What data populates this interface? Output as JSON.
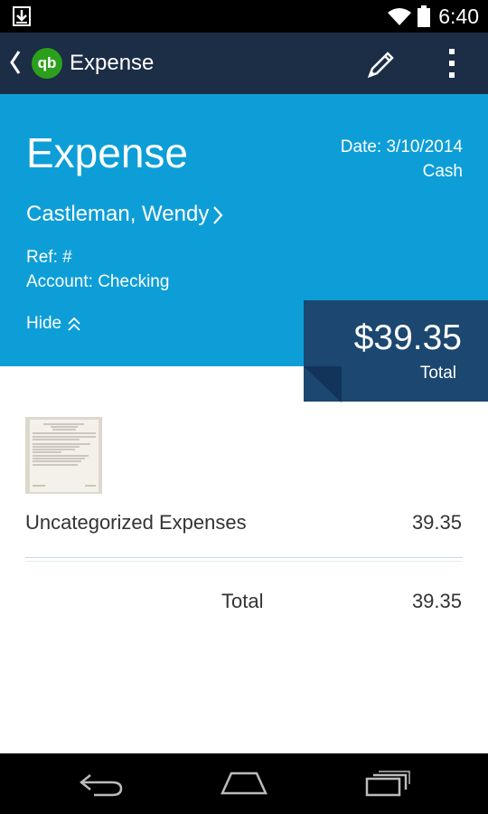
{
  "status_bar": {
    "time": "6:40"
  },
  "action_bar": {
    "app_logo": "qb",
    "title": "Expense"
  },
  "header": {
    "title": "Expense",
    "date": "Date: 3/10/2014",
    "payment_method": "Cash",
    "payee": "Castleman, Wendy",
    "ref": "Ref: #",
    "account": "Account: Checking",
    "hide_label": "Hide",
    "total_amount": "$39.35",
    "total_label": "Total"
  },
  "lines": [
    {
      "name": "Uncategorized Expenses",
      "amount": "39.35"
    }
  ],
  "summary": {
    "total_label": "Total",
    "total_amount": "39.35"
  },
  "colors": {
    "action_bar": "#1c2d46",
    "header": "#0d9ed8",
    "total_box": "#1c4770",
    "brand_green": "#2ca01c"
  },
  "icons": [
    "download-icon",
    "wifi-icon",
    "battery-icon",
    "back-chevron-icon",
    "edit-pencil-icon",
    "overflow-menu-icon",
    "chevron-right-icon",
    "chevron-up-icon",
    "nav-back-icon",
    "nav-home-icon",
    "nav-recents-icon"
  ]
}
